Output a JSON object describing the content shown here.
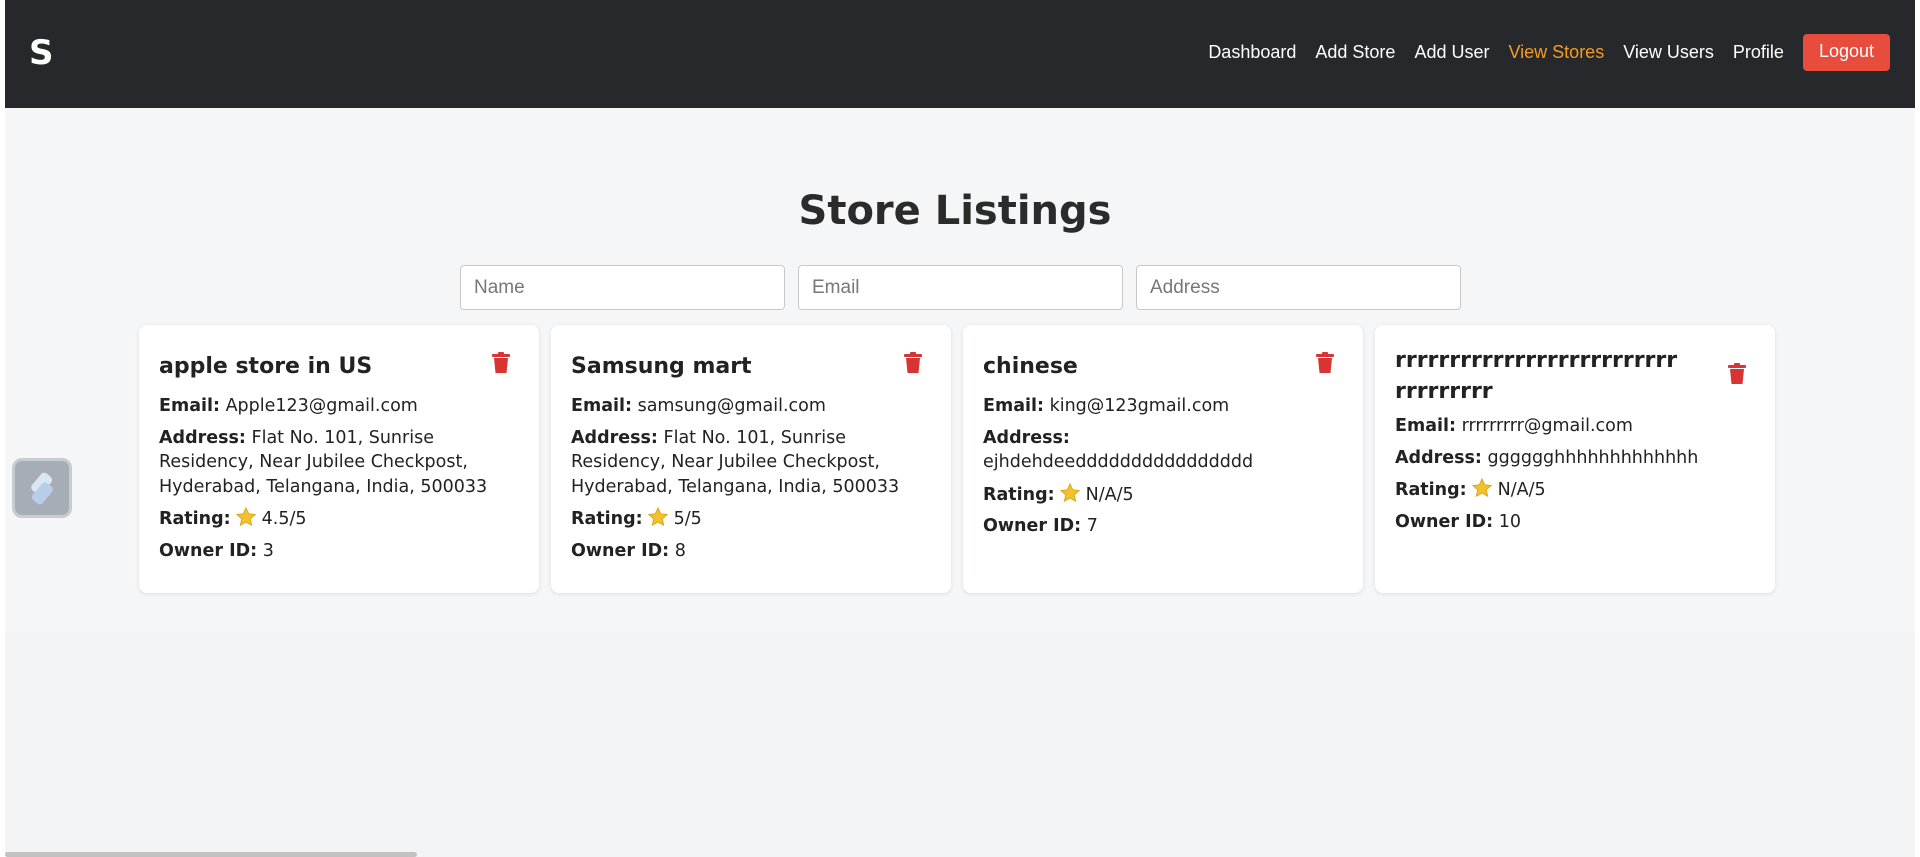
{
  "navbar": {
    "logo": "S",
    "links": [
      "Dashboard",
      "Add Store",
      "Add User",
      "View Stores",
      "View Users",
      "Profile"
    ],
    "active": "View Stores",
    "logout_label": "Logout"
  },
  "page": {
    "title": "Store Listings"
  },
  "filters": {
    "name_placeholder": "Name",
    "email_placeholder": "Email",
    "address_placeholder": "Address"
  },
  "labels": {
    "email": "Email:",
    "address": "Address:",
    "rating": "Rating:",
    "owner_id": "Owner ID:"
  },
  "stores": [
    {
      "name": "apple store in US",
      "email": "Apple123@gmail.com",
      "address": "Flat No. 101, Sunrise Residency, Near Jubilee Checkpost, Hyderabad, Telangana, India, 500033",
      "rating": "4.5/5",
      "owner_id": "3"
    },
    {
      "name": "Samsung mart",
      "email": "samsung@gmail.com",
      "address": "Flat No. 101, Sunrise Residency, Near Jubilee Checkpost, Hyderabad, Telangana, India, 500033",
      "rating": "5/5",
      "owner_id": "8"
    },
    {
      "name": "chinese",
      "email": "king@123gmail.com",
      "address": "ejhdehdeedddddddddddddddd",
      "rating": "N/A/5",
      "owner_id": "7"
    },
    {
      "name": "rrrrrrrrrrrrrrrrrrrrrrrrrrrrrrrrrrr",
      "email": "rrrrrrrrr@gmail.com",
      "address": "gggggghhhhhhhhhhhhh",
      "rating": "N/A/5",
      "owner_id": "10"
    }
  ],
  "icons": {
    "trash": "trash-icon",
    "star": "star-icon",
    "side_widget": "extension-icon"
  },
  "colors": {
    "navbar_bg": "#27282b",
    "active_link": "#f39c23",
    "logout_bg": "#e74c3c",
    "trash": "#d93434",
    "star": "#f2c12e"
  }
}
